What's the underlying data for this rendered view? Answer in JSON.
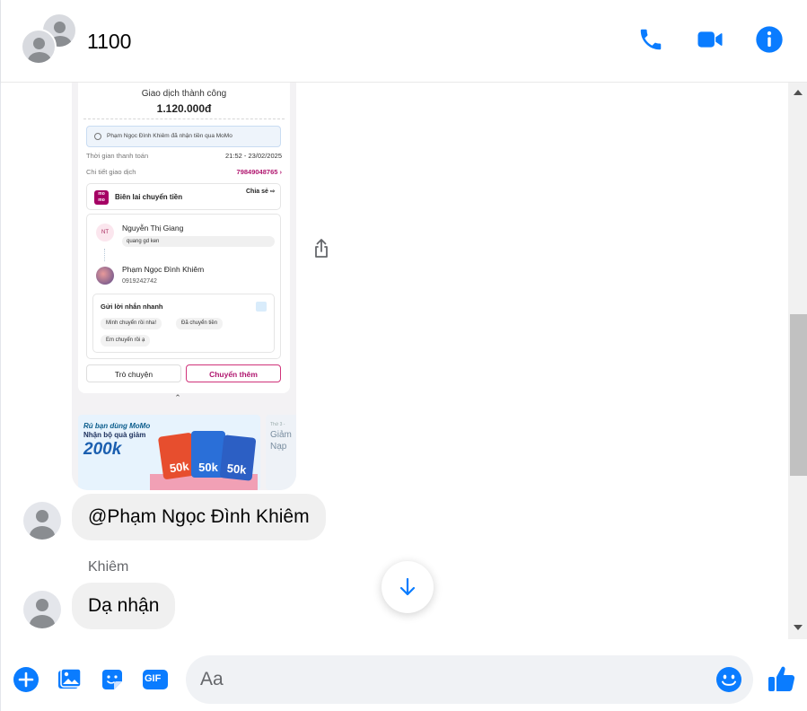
{
  "header": {
    "title": "1100",
    "icons": [
      "phone-icon",
      "video-icon",
      "info-icon"
    ]
  },
  "receipt": {
    "status": "Giao dịch thành công",
    "amount": "1.120.000đ",
    "note": "Phạm Ngọc Đình Khiêm đã nhận tiền qua MoMo",
    "time_label": "Thời gian thanh toán",
    "time_value": "21:52 - 23/02/2025",
    "detail_label": "Chi tiết giao dịch",
    "detail_value": "79849048765 ›",
    "logo": "mo mo",
    "card_title": "Biên lai chuyển tiền",
    "share_label": "Chia sẻ ⇨",
    "sender_initials": "NT",
    "sender_name": "Nguyễn Thị Giang",
    "sender_message": "quang gd ken",
    "receiver_name": "Phạm Ngọc Đình Khiêm",
    "receiver_phone": "0919242742",
    "quick_title": "Gửi lời nhắn nhanh",
    "quick_chips": [
      "Mình chuyển rồi nha!",
      "Đã chuyển tiền",
      "Em chuyển rồi ạ"
    ],
    "btn_chat": "Trò chuyện",
    "btn_more": "Chuyển thêm",
    "chevron": "⌃",
    "banner_line1": "Rủ bạn dùng MoMo",
    "banner_line2": "Nhận bộ quà giảm",
    "banner_amount": "200k",
    "banner_cards": [
      "50k",
      "50k",
      "50k"
    ],
    "banner2_small": "Thứ 3 -",
    "banner2_text": "Giảm Nạp"
  },
  "messages": [
    {
      "text": "@Phạm Ngọc Đình Khiêm"
    },
    {
      "sender": "Khiêm",
      "text": "Dạ nhận"
    }
  ],
  "composer": {
    "placeholder": "Aa",
    "icons": [
      "plus-icon",
      "image-icon",
      "sticker-icon",
      "gif-icon",
      "emoji-icon",
      "thumbs-up-icon"
    ],
    "gif_label": "GIF"
  },
  "colors": {
    "accent": "#0a7cff",
    "bubble": "#f0f0f0",
    "momo": "#a50064"
  }
}
